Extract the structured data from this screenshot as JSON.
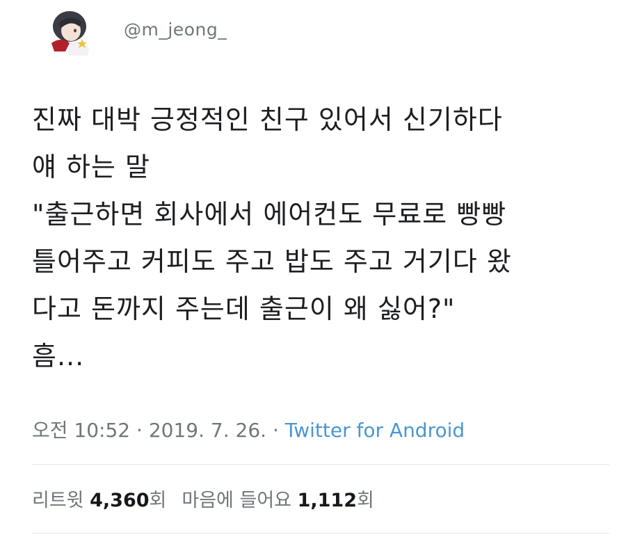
{
  "tweet": {
    "handle": "@m_jeong_",
    "lines": [
      "진짜 대박 긍정적인 친구 있어서 신기하다",
      "얘 하는 말",
      "\"출근하면 회사에서 에어컨도 무료로 빵빵",
      "틀어주고 커피도 주고 밥도 주고 거기다 왔",
      "다고 돈까지 주는데 출근이 왜 싫어?\"",
      "흠..."
    ],
    "time": "오전 10:52",
    "separator": "·",
    "date": "2019. 7. 26.",
    "source": "Twitter for Android",
    "retweets_label": "리트윗",
    "retweets_count": "4,360",
    "retweets_unit": "회",
    "likes_label": "마음에 들어요",
    "likes_count": "1,112",
    "likes_unit": "회"
  },
  "colors": {
    "text": "#1c1e21",
    "meta": "#6f767b",
    "link": "#4a97d0",
    "divider": "#e3e6e8"
  }
}
